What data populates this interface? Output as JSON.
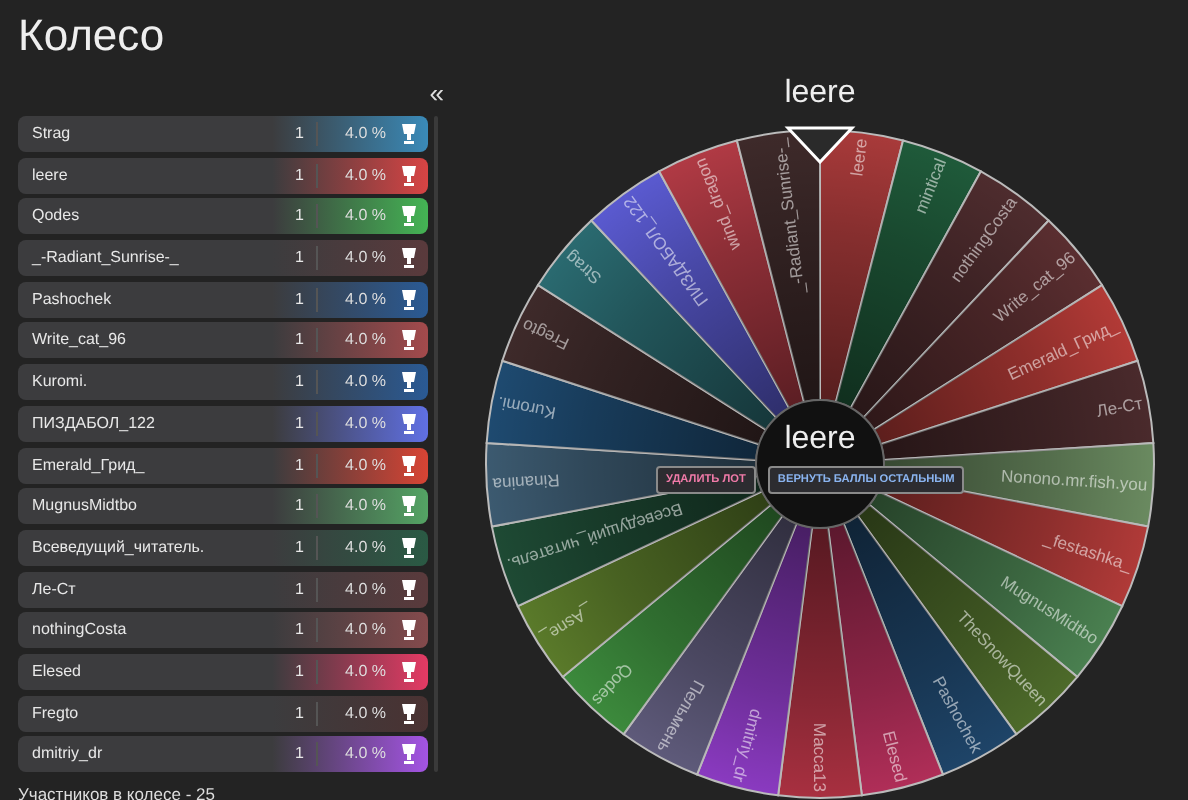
{
  "title": "Колесо",
  "collapse_toggle": "«",
  "participants": [
    {
      "name": "Strag",
      "count": "1",
      "percent": "4.0 %",
      "color": "#3a8ab8"
    },
    {
      "name": "leere",
      "count": "1",
      "percent": "4.0 %",
      "color": "#d84444"
    },
    {
      "name": "Qodes",
      "count": "1",
      "percent": "4.0 %",
      "color": "#44b454"
    },
    {
      "name": "_-Radiant_Sunrise-_",
      "count": "1",
      "percent": "4.0 %",
      "color": "#5a3a3c"
    },
    {
      "name": "Pashochek",
      "count": "1",
      "percent": "4.0 %",
      "color": "#2a5a94"
    },
    {
      "name": "Write_cat_96",
      "count": "1",
      "percent": "4.0 %",
      "color": "#a44a4c"
    },
    {
      "name": "Kuromi.",
      "count": "1",
      "percent": "4.0 %",
      "color": "#2a5a94"
    },
    {
      "name": "ПИЗДАБОЛ_122",
      "count": "1",
      "percent": "4.0 %",
      "color": "#6070e4"
    },
    {
      "name": "Emerald_Грид_",
      "count": "1",
      "percent": "4.0 %",
      "color": "#d84434"
    },
    {
      "name": "MugnusMidtbo",
      "count": "1",
      "percent": "4.0 %",
      "color": "#54a464"
    },
    {
      "name": "Всеведущий_читатель.",
      "count": "1",
      "percent": "4.0 %",
      "color": "#2a5a44"
    },
    {
      "name": "Ле-Ст",
      "count": "1",
      "percent": "4.0 %",
      "color": "#5a3a3c"
    },
    {
      "name": "nothingCosta",
      "count": "1",
      "percent": "4.0 %",
      "color": "#844a4c"
    },
    {
      "name": "Elesed",
      "count": "1",
      "percent": "4.0 %",
      "color": "#e43a64"
    },
    {
      "name": "Fregto",
      "count": "1",
      "percent": "4.0 %",
      "color": "#4a3232"
    },
    {
      "name": "dmitriy_dr",
      "count": "1",
      "percent": "4.0 %",
      "color": "#a454e4"
    }
  ],
  "footer": "Участников в колесе - 25",
  "winner": "leere",
  "wheel": {
    "center_label": "leere",
    "segments": [
      {
        "label": "leere",
        "color": "#a83a3a"
      },
      {
        "label": "mintical",
        "color": "#1f5a3a"
      },
      {
        "label": "nothingCosta",
        "color": "#4e2c2e"
      },
      {
        "label": "Write_cat_96",
        "color": "#5a2e30"
      },
      {
        "label": "Emerald_Грид_",
        "color": "#b23a36"
      },
      {
        "label": "Ле-Ст",
        "color": "#4a2a2c"
      },
      {
        "label": "Nonono.mr.fish.you",
        "color": "#6a8a60"
      },
      {
        "label": "_festashka_",
        "color": "#b03a38"
      },
      {
        "label": "MugnusMidtbo",
        "color": "#4a8050"
      },
      {
        "label": "TheSnowQueen",
        "color": "#4d6a2a"
      },
      {
        "label": "Pashochek",
        "color": "#1e4468"
      },
      {
        "label": "Elesed",
        "color": "#b02e58"
      },
      {
        "label": "Масса13",
        "color": "#a83040"
      },
      {
        "label": "dmitriy_dr",
        "color": "#8a3ac0"
      },
      {
        "label": "Пельмень",
        "color": "#5e5a7a"
      },
      {
        "label": "Qodes",
        "color": "#3c8a3c"
      },
      {
        "label": "_Asne_",
        "color": "#5a7a2a"
      },
      {
        "label": "Всеведущий_читатель.",
        "color": "#1e4a34"
      },
      {
        "label": "Rinanina",
        "color": "#3c5a70"
      },
      {
        "label": "Kuromi.",
        "color": "#1e4a70"
      },
      {
        "label": "Fregto",
        "color": "#3e2a2a"
      },
      {
        "label": "Strag",
        "color": "#2a6a70"
      },
      {
        "label": "ПИЗДАБОЛ_122",
        "color": "#5a5ad0"
      },
      {
        "label": "wind_dragon",
        "color": "#b03a44"
      },
      {
        "label": "_-Radiant_Sunrise-_",
        "color": "#3e2a2a"
      }
    ],
    "buttons": [
      {
        "label": "УДАЛИТЬ ЛОТ",
        "kind": "danger"
      },
      {
        "label": "ВЕРНУТЬ БАЛЛЫ ОСТАЛЬНЫМ",
        "kind": "primary"
      }
    ]
  }
}
